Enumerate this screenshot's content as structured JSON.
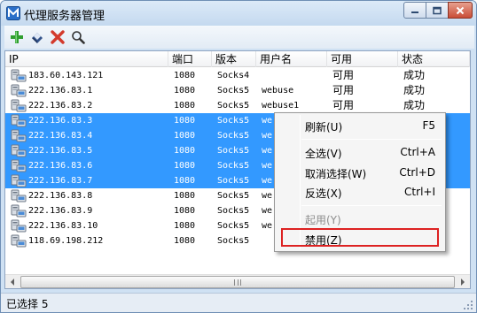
{
  "window": {
    "title": "代理服务器管理",
    "controls": [
      "minimize-icon",
      "maximize-icon",
      "close-icon"
    ]
  },
  "toolbar": {
    "buttons": [
      {
        "icon": "add-icon",
        "color": "#2f9e2f"
      },
      {
        "icon": "edit-icon",
        "color": "#33538a"
      },
      {
        "icon": "delete-icon",
        "color": "#d33a2c"
      },
      {
        "icon": "search-icon",
        "color": "#333333"
      }
    ]
  },
  "list": {
    "columns": [
      "IP",
      "端口",
      "版本",
      "用户名",
      "可用",
      "状态"
    ],
    "rows": [
      {
        "ip": "183.60.143.121",
        "port": "1080",
        "version": "Socks4",
        "user": "",
        "available": "可用",
        "status": "成功",
        "selected": false
      },
      {
        "ip": "222.136.83.1",
        "port": "1080",
        "version": "Socks5",
        "user": "webuse",
        "available": "可用",
        "status": "成功",
        "selected": false
      },
      {
        "ip": "222.136.83.2",
        "port": "1080",
        "version": "Socks5",
        "user": "webuse1",
        "available": "可用",
        "status": "成功",
        "selected": false
      },
      {
        "ip": "222.136.83.3",
        "port": "1080",
        "version": "Socks5",
        "user": "we",
        "available": "",
        "status": "",
        "selected": true
      },
      {
        "ip": "222.136.83.4",
        "port": "1080",
        "version": "Socks5",
        "user": "we",
        "available": "",
        "status": "",
        "selected": true
      },
      {
        "ip": "222.136.83.5",
        "port": "1080",
        "version": "Socks5",
        "user": "we",
        "available": "",
        "status": "",
        "selected": true
      },
      {
        "ip": "222.136.83.6",
        "port": "1080",
        "version": "Socks5",
        "user": "we",
        "available": "",
        "status": "",
        "selected": true
      },
      {
        "ip": "222.136.83.7",
        "port": "1080",
        "version": "Socks5",
        "user": "we",
        "available": "",
        "status": "",
        "selected": true
      },
      {
        "ip": "222.136.83.8",
        "port": "1080",
        "version": "Socks5",
        "user": "we",
        "available": "",
        "status": "",
        "selected": false
      },
      {
        "ip": "222.136.83.9",
        "port": "1080",
        "version": "Socks5",
        "user": "we",
        "available": "",
        "status": "",
        "selected": false
      },
      {
        "ip": "222.136.83.10",
        "port": "1080",
        "version": "Socks5",
        "user": "we",
        "available": "",
        "status": "",
        "selected": false
      },
      {
        "ip": "118.69.198.212",
        "port": "1080",
        "version": "Socks5",
        "user": "",
        "available": "",
        "status": "",
        "selected": false
      }
    ]
  },
  "context_menu": {
    "items": [
      {
        "label": "刷新(U)",
        "shortcut": "F5",
        "disabled": false
      },
      {
        "label": "全选(V)",
        "shortcut": "Ctrl+A",
        "disabled": false
      },
      {
        "label": "取消选择(W)",
        "shortcut": "Ctrl+D",
        "disabled": false
      },
      {
        "label": "反选(X)",
        "shortcut": "Ctrl+I",
        "disabled": false
      },
      {
        "label": "起用(Y)",
        "shortcut": "",
        "disabled": true
      },
      {
        "label": "禁用(Z)",
        "shortcut": "",
        "disabled": false
      }
    ],
    "highlight_color": "#dd2222"
  },
  "statusbar": {
    "text": "已选择 5"
  },
  "colors": {
    "selection": "#3399ff",
    "title_bar": "#cfe1f3"
  }
}
